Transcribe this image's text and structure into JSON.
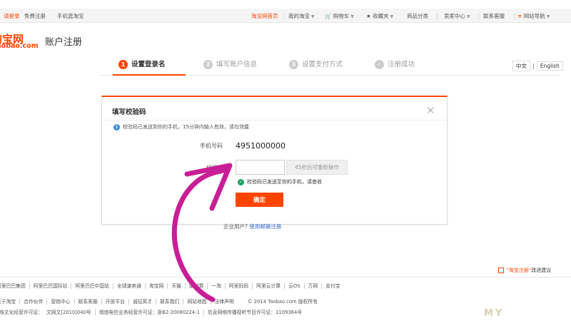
{
  "topbar": {
    "login": "请登录",
    "register": "免费注册",
    "mobile": "手机逛淘宝",
    "home": "淘宝网首页",
    "my_taobao": "我的淘宝",
    "cart": "购物车",
    "favorites": "收藏夹",
    "categories": "商品分类",
    "seller": "卖家中心",
    "service": "联系客服",
    "site_nav": "网站导航"
  },
  "header": {
    "logo_main": "淘宝网",
    "logo_sub": "Taobao.com",
    "title": "账户注册"
  },
  "steps": [
    {
      "num": "1",
      "label": "设置登录名"
    },
    {
      "num": "2",
      "label": "填写账户信息"
    },
    {
      "num": "3",
      "label": "设置支付方式"
    },
    {
      "num": "✓",
      "label": "注册成功"
    }
  ],
  "lang": {
    "zh": "中文",
    "sep": "|",
    "en": "English"
  },
  "dialog": {
    "title": "填写校验码",
    "close": "✕",
    "info": "校验码已发送到你的手机，15分钟内输入有效，请勿泄露",
    "phone_label": "手机号码",
    "phone_value": "4951000000",
    "code_label": "校验码",
    "code_value": "",
    "code_placeholder": "",
    "resend": "45秒后可重新操作",
    "sent_note": "校验码已发送至你的手机，请查收",
    "confirm": "确定"
  },
  "existing": {
    "prefix": "企业用户?",
    "link": "使用邮箱注册"
  },
  "feedback": {
    "text": "“淘宝注册”",
    "suffix": "改进建议"
  },
  "footer": {
    "row1": [
      "阿里巴巴集团",
      "阿里巴巴国际站",
      "阿里巴巴中国站",
      "全球速卖通",
      "淘宝网",
      "天猫",
      "聚划算",
      "一淘",
      "阿里妈妈",
      "阿里云计算",
      "云OS",
      "万网",
      "支付宝"
    ],
    "row2": [
      "关于淘宝",
      "合作伙伴",
      "营销中心",
      "联系客服",
      "开放平台",
      "诚征英才",
      "联系我们",
      "网站地图",
      "法律声明"
    ],
    "copyright": "© 2014 Taobao.com 版权所有",
    "row3": [
      "网络文化经营许可证：",
      "文网文[2010]040号",
      "增值电信业务经营许可证：浙B2-20080224-1",
      "信息网络传播视听节目许可证：1109364号"
    ]
  },
  "watermark": "MY",
  "colors": {
    "accent": "#ff4400",
    "annotation": "#c81e96",
    "link": "#3366cc"
  },
  "icons": {
    "cart": "cart-icon",
    "favorites": "star-icon",
    "info": "info-icon",
    "check": "check-icon",
    "close": "close-icon"
  }
}
